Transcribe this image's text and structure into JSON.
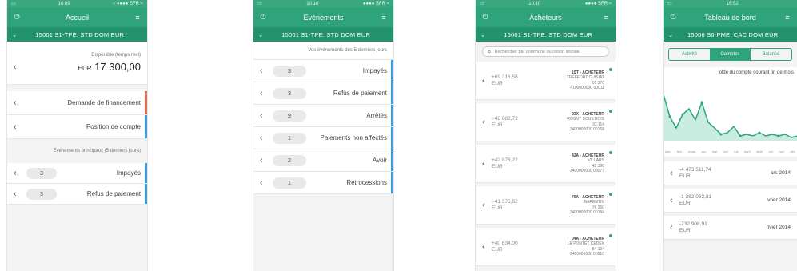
{
  "colors": {
    "brand": "#2fa37c",
    "brand_dark": "#23936d",
    "orange": "#e2704e",
    "blue": "#3f9ddc"
  },
  "s1": {
    "status_left": "○ ●●●● SFR ≈",
    "status_time": "10:09",
    "status_right": "▭",
    "title": "Accueil",
    "sub": "15001 S1-TPE. STD DOM EUR",
    "dispo_label": "Disponible (temps réel)",
    "dispo_amount": "17 300,00",
    "dispo_cur": "EUR",
    "rows": [
      {
        "label": "Demande de financement",
        "bar": "#e2704e"
      },
      {
        "label": "Position de compte",
        "bar": "#3f9ddc"
      }
    ],
    "section": "Evénements principaux (5 derniers jours)",
    "events": [
      {
        "label": "Impayés",
        "count": "3"
      },
      {
        "label": "Refus de paiement",
        "count": "3"
      }
    ]
  },
  "s2": {
    "status_time": "10:10",
    "status_right": "●●●● SFR ≈",
    "title": "Evénements",
    "sub": "15001 S1-TPE. STD DOM EUR",
    "note": "Vos événements des 5 derniers jours",
    "events": [
      {
        "label": "Impayés",
        "count": "3"
      },
      {
        "label": "Refus de paiement",
        "count": "3"
      },
      {
        "label": "Arrêtés",
        "count": "9"
      },
      {
        "label": "Paiements non affectés",
        "count": "1"
      },
      {
        "label": "Avoir",
        "count": "2"
      },
      {
        "label": "Rétrocessions",
        "count": "1"
      }
    ]
  },
  "s3": {
    "status_time": "10:10",
    "status_right": "●●●● SFR ≈",
    "title": "Acheteurs",
    "sub": "15001 S1-TPE. STD DOM EUR",
    "search_placeholder": "Rechercher par commune ou raison sociale",
    "buyers": [
      {
        "amount": "+69 316,58",
        "cur": "EUR",
        "name": "1ST - ACHETEUR",
        "city": "TREFFORT CUISIAT",
        "code": "01 370",
        "id": "4100000000 00011"
      },
      {
        "amount": "+48 682,72",
        "cur": "EUR",
        "name": "93X - ACHETEUR",
        "city": "ROSNY SOUS BOIS",
        "code": "93 114",
        "id": "3400000000 00168"
      },
      {
        "amount": "+42 878,22",
        "cur": "EUR",
        "name": "42A - ACHETEUR",
        "city": "VILLARS",
        "code": "42 390",
        "id": "3400000000 00077"
      },
      {
        "amount": "+41 376,52",
        "cur": "EUR",
        "name": "76A - ACHETEUR",
        "city": "BARENTIN",
        "code": "76 360",
        "id": "3400000000 00184"
      },
      {
        "amount": "+40 634,00",
        "cur": "EUR",
        "name": "04A - ACHETEUR",
        "city": "LE PONTET CEDEX",
        "code": "84 134",
        "id": "3400000000 00010"
      }
    ]
  },
  "s4": {
    "status_time": "16:52",
    "status_right": "",
    "title": "Tableau de bord",
    "sub": "15006 S6-PME. CAC DOM EUR",
    "tabs": [
      "Balance",
      "Comptes",
      "Activité"
    ],
    "chart_title": "olde du compte courant fin de mois",
    "months": [
      "janv",
      "févr",
      "mars",
      "avr",
      "mai",
      "juin",
      "juil",
      "août",
      "sept",
      "oct",
      "nov",
      "déc"
    ],
    "rows": [
      {
        "amount": "-4 473 511,74",
        "cur": "EUR",
        "label": "ars 2014"
      },
      {
        "amount": "-1 382 082,81",
        "cur": "EUR",
        "label": "vrier 2014"
      },
      {
        "amount": "-732 908,91",
        "cur": "EUR",
        "label": "nvier 2014"
      }
    ]
  }
}
